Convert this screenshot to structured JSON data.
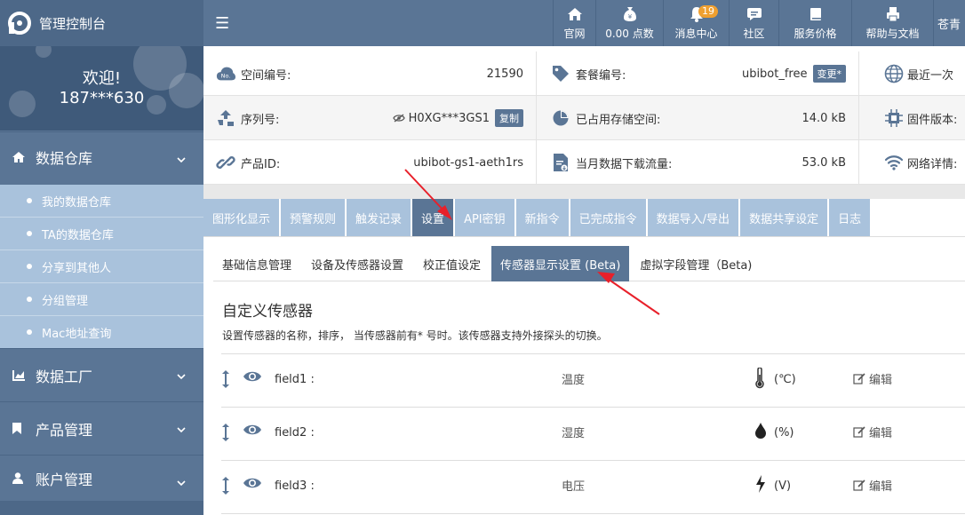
{
  "brand": {
    "title": "管理控制台"
  },
  "nav": [
    {
      "label": "官网",
      "icon": "home-icon"
    },
    {
      "label": "0.00 点数",
      "icon": "money-bag-icon"
    },
    {
      "label": "消息中心",
      "icon": "bell-icon",
      "badge": "19"
    },
    {
      "label": "社区",
      "icon": "chat-icon"
    },
    {
      "label": "服务价格",
      "icon": "book-icon"
    },
    {
      "label": "帮助与文档",
      "icon": "printer-icon"
    },
    {
      "label": "苍青",
      "icon": ""
    }
  ],
  "sidebar": {
    "welcome": "欢迎!",
    "user": "187***630",
    "sections": [
      {
        "label": "数据仓库",
        "icon": "home-icon"
      },
      {
        "label": "数据工厂",
        "icon": "chart-icon"
      },
      {
        "label": "产品管理",
        "icon": "bookmark-icon"
      },
      {
        "label": "账户管理",
        "icon": "user-icon"
      }
    ],
    "subitems": [
      "我的数据仓库",
      "TA的数据仓库",
      "分享到其他人",
      "分组管理",
      "Mac地址查询"
    ]
  },
  "info": {
    "space_label": "空间编号:",
    "space_value": "21590",
    "plan_label": "套餐编号:",
    "plan_value": "ubibot_free",
    "plan_button": "变更*",
    "recent_label": "最近一次",
    "serial_label": "序列号:",
    "serial_value": "H0XG***3GS1",
    "serial_button": "复制",
    "storage_label": "已占用存储空间:",
    "storage_value": "14.0 kB",
    "firmware_label": "固件版本:",
    "product_label": "产品ID:",
    "product_value": "ubibot-gs1-aeth1rs",
    "download_label": "当月数据下载流量:",
    "download_value": "53.0 kB",
    "network_label": "网络详情:"
  },
  "tabs": [
    "图形化显示",
    "预警规则",
    "触发记录",
    "设置",
    "API密钥",
    "新指令",
    "已完成指令",
    "数据导入/导出",
    "数据共享设定",
    "日志"
  ],
  "active_tab": 3,
  "subtabs": [
    "基础信息管理",
    "设备及传感器设置",
    "校正值设定",
    "传感器显示设置 (Beta)",
    "虚拟字段管理（Beta)"
  ],
  "active_subtab": 3,
  "section": {
    "title": "自定义传感器",
    "desc": "设置传感器的名称，排序， 当传感器前有* 号时。该传感器支持外接探头的切换。"
  },
  "sensors": [
    {
      "field": "field1 :",
      "type": "温度",
      "unit": "(℃)",
      "icon": "thermometer-icon",
      "edit": "编辑"
    },
    {
      "field": "field2 :",
      "type": "湿度",
      "unit": "(%)",
      "icon": "droplet-icon",
      "edit": "编辑"
    },
    {
      "field": "field3 :",
      "type": "电压",
      "unit": "(V)",
      "icon": "bolt-icon",
      "edit": "编辑"
    }
  ],
  "colors": {
    "primary": "#5a7595",
    "tab_inactive": "#a9c2dc",
    "arrow": "#e8202a"
  }
}
